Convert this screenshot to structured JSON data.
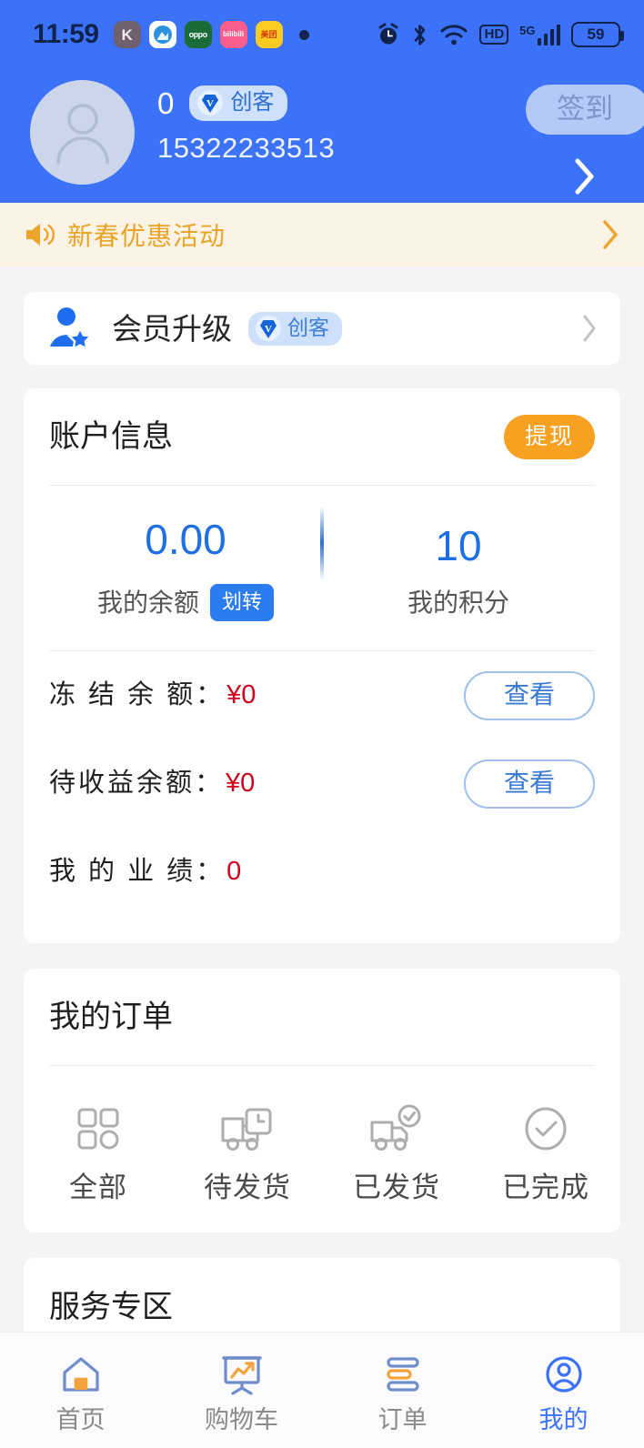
{
  "statusbar": {
    "time": "11:59",
    "apps": [
      {
        "name": "kuaishou",
        "glyph": "K"
      },
      {
        "name": "browser",
        "glyph": ""
      },
      {
        "name": "oppo",
        "glyph": "oppo"
      },
      {
        "name": "bilibili",
        "glyph": "bilibili"
      },
      {
        "name": "meituan",
        "glyph": "美团"
      }
    ],
    "hd_label": "HD",
    "network_label": "5G",
    "battery_level": "59"
  },
  "header": {
    "username": "0",
    "level_badge": "创客",
    "phone": "15322233513",
    "signin_label": "签到"
  },
  "notice": {
    "text": "新春优惠活动"
  },
  "member": {
    "title": "会员升级",
    "badge": "创客"
  },
  "account": {
    "title": "账户信息",
    "withdraw_label": "提现",
    "balance_value": "0.00",
    "balance_label": "我的余额",
    "transfer_label": "划转",
    "points_value": "10",
    "points_label": "我的积分",
    "rows": [
      {
        "label": "冻 结 余 额：",
        "value": "¥0",
        "action": "查看",
        "has_action": true
      },
      {
        "label": "待收益余额：",
        "value": "¥0",
        "action": "查看",
        "has_action": true
      },
      {
        "label": "我 的 业 绩：",
        "value": "0",
        "action": "",
        "has_action": false
      }
    ]
  },
  "orders": {
    "title": "我的订单",
    "items": [
      {
        "label": "全部",
        "icon": "grid-icon"
      },
      {
        "label": "待发货",
        "icon": "truck-clock-icon"
      },
      {
        "label": "已发货",
        "icon": "truck-check-icon"
      },
      {
        "label": "已完成",
        "icon": "circle-check-icon"
      }
    ]
  },
  "service": {
    "title": "服务专区"
  },
  "tabbar": {
    "items": [
      {
        "label": "首页",
        "icon": "home-icon",
        "active": false
      },
      {
        "label": "购物车",
        "icon": "cart-board-icon",
        "active": false
      },
      {
        "label": "订单",
        "icon": "list-icon",
        "active": false
      },
      {
        "label": "我的",
        "icon": "person-circle-icon",
        "active": true
      }
    ]
  },
  "colors": {
    "brand_blue": "#3b72f7",
    "accent_orange": "#f6a121",
    "notice_bg": "#fbf3e6",
    "notice_text": "#e8a427",
    "value_red": "#d0021b",
    "link_blue": "#3a7ad4"
  }
}
